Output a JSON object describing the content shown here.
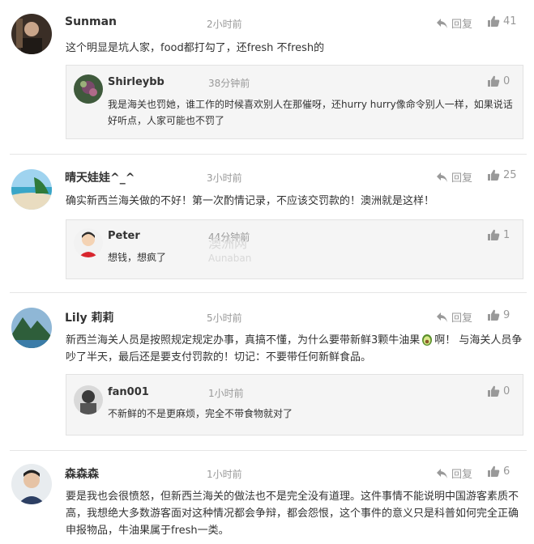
{
  "labels": {
    "reply": "回复"
  },
  "comments": [
    {
      "user": "Sunman",
      "time": "2小时前",
      "likes": "41",
      "text": "这个明显是坑人家，food都打勾了，还fresh 不fresh的",
      "reply": {
        "user": "Shirleybb",
        "time": "38分钟前",
        "likes": "0",
        "text": "我是海关也罚她，谁工作的时候喜欢别人在那催呀，还hurry hurry像命令别人一样，如果说话好听点，人家可能也不罚了"
      }
    },
    {
      "user": "晴天娃娃^_^",
      "time": "3小时前",
      "likes": "25",
      "text": "确实新西兰海关做的不好！第一次酌情记录，不应该交罚款的！澳洲就是这样！",
      "reply": {
        "user": "Peter",
        "time": "44分钟前",
        "likes": "1",
        "text": "想钱，想疯了"
      }
    },
    {
      "user": "Lily 莉莉",
      "time": "5小时前",
      "likes": "9",
      "text_a": "新西兰海关人员是按照规定规定办事，真搞不懂，为什么要带新鲜3颗牛油果",
      "text_b": "啊！ 与海关人员争吵了半天，最后还是要支付罚款的！切记：不要带任何新鲜食品。",
      "reply": {
        "user": "fan001",
        "time": "1小时前",
        "likes": "0",
        "text": "不新鲜的不是更麻烦，完全不带食物就对了"
      }
    },
    {
      "user": "森森森",
      "time": "1小时前",
      "likes": "6",
      "text": "要是我也会很愤怒，但新西兰海关的做法也不是完全没有道理。这件事情不能说明中国游客素质不高，我想绝大多数游客面对这种情况都会争辩，都会怨恨，这个事件的意义只是科普如何完全正确申报物品，牛油果属于fresh一类。"
    }
  ],
  "watermark": {
    "cn": "澳洲网",
    "en": "Aunaban"
  },
  "colors": {
    "text": "#333333",
    "muted": "#999999",
    "reply_bg": "#f5f5f5",
    "divider": "#e5e5e5"
  }
}
